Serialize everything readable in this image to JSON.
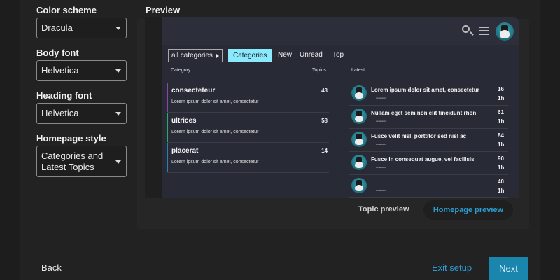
{
  "settings": {
    "color_scheme": {
      "label": "Color scheme",
      "value": "Dracula"
    },
    "body_font": {
      "label": "Body font",
      "value": "Helvetica"
    },
    "heading_font": {
      "label": "Heading font",
      "value": "Helvetica"
    },
    "homepage_style": {
      "label": "Homepage style",
      "value_line1": "Categories and",
      "value_line2": "Latest Topics"
    }
  },
  "preview": {
    "label": "Preview",
    "nav": {
      "all_categories": "all categories",
      "tabs": [
        "Categories",
        "New",
        "Unread",
        "Top"
      ]
    },
    "categories_header": {
      "category": "Category",
      "topics": "Topics"
    },
    "categories": [
      {
        "name": "consecteteur",
        "desc": "Lorem ipsum dolor sit amet, consectetur",
        "count": "43",
        "color": "#8e44ad"
      },
      {
        "name": "ultrices",
        "desc": "Lorem ipsum dolor sit amet, consectetur",
        "count": "58",
        "color": "#27ae60"
      },
      {
        "name": "placerat",
        "desc": "Lorem ipsum dolor sit amet, consectetur",
        "count": "14",
        "color": "#2980b9"
      }
    ],
    "latest_header": "Latest",
    "latest": [
      {
        "title": "Lorem ipsum dolor sit amet, consectetur",
        "sub": "consectetur",
        "count": "16",
        "time": "1h"
      },
      {
        "title": "Nullam eget sem non elit tincidunt rhon",
        "sub": "consectetur",
        "count": "61",
        "time": "1h"
      },
      {
        "title": "Fusce velit nisl, porttitor sed nisl ac",
        "sub": "consectetur",
        "count": "84",
        "time": "1h"
      },
      {
        "title": "Fusce in consequat augue, vel facilisis",
        "sub": "consectetur",
        "count": "90",
        "time": "1h"
      },
      {
        "title": "",
        "sub": "consectetur",
        "count": "40",
        "time": "1h"
      }
    ],
    "tabs": {
      "topic": "Topic preview",
      "homepage": "Homepage preview"
    }
  },
  "footer": {
    "back": "Back",
    "exit": "Exit setup",
    "next": "Next"
  },
  "colors": {
    "accent": "#1b86ad",
    "link": "#2e9bd2",
    "active_tab": "#8be9fd"
  }
}
